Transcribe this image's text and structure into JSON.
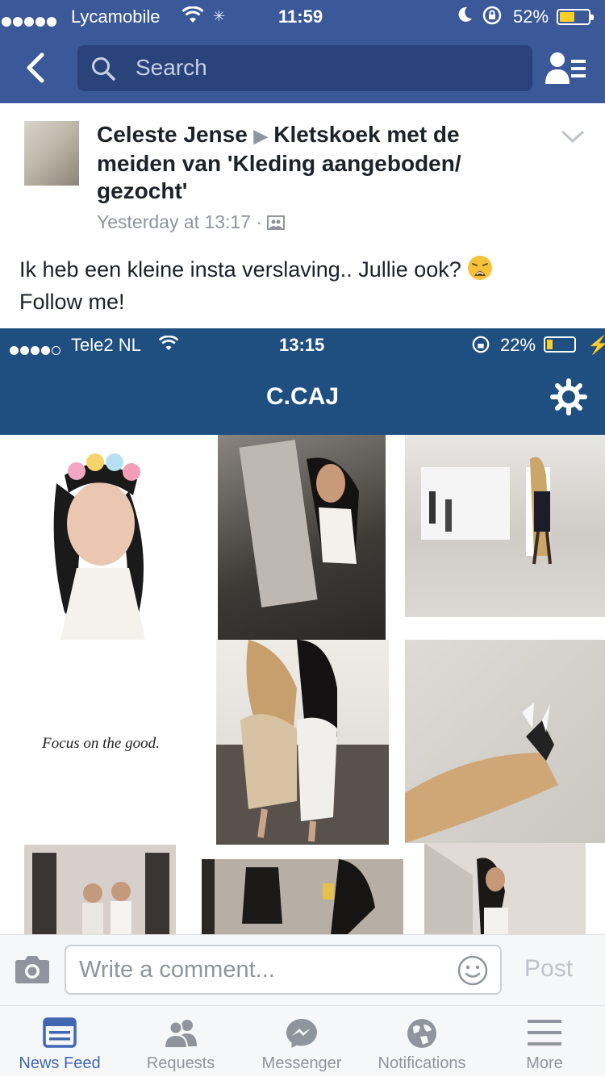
{
  "status_bar": {
    "carrier": "Lycamobile",
    "time": "11:59",
    "battery_percent": "52%",
    "battery_level": 0.52,
    "signal_dots": 5
  },
  "nav": {
    "search_placeholder": "Search"
  },
  "post": {
    "author": "Celeste Jense",
    "group": "Kletskoek met de meiden van 'Kleding aangeboden/ gezocht'",
    "timestamp": "Yesterday at 13:17",
    "separator": "·",
    "privacy_icon": "group-members-icon",
    "text_line1": "Ik heb een kleine insta verslaving.. Jullie ook?",
    "text_line2": "Follow me!",
    "emoji": "weary-face-emoji"
  },
  "shared_screenshot": {
    "status_bar": {
      "carrier": "Tele2 NL",
      "time": "13:15",
      "battery_percent": "22%",
      "battery_level": 0.22
    },
    "title": "C.CAJ",
    "caption": "Focus on the good."
  },
  "comment_bar": {
    "placeholder": "Write a comment...",
    "post_label": "Post"
  },
  "tabs": [
    {
      "label": "News Feed",
      "icon": "news-feed-icon",
      "active": true
    },
    {
      "label": "Requests",
      "icon": "friend-requests-icon",
      "active": false
    },
    {
      "label": "Messenger",
      "icon": "messenger-icon",
      "active": false
    },
    {
      "label": "Notifications",
      "icon": "globe-icon",
      "active": false
    },
    {
      "label": "More",
      "icon": "menu-icon",
      "active": false
    }
  ],
  "colors": {
    "facebook_blue": "#3b5998",
    "search_bg": "#2a437a",
    "active_tab": "#4267b2",
    "inactive_gray": "#90949c",
    "instagram_blue": "#1f4f80",
    "battery_yellow": "#f7d02c"
  }
}
